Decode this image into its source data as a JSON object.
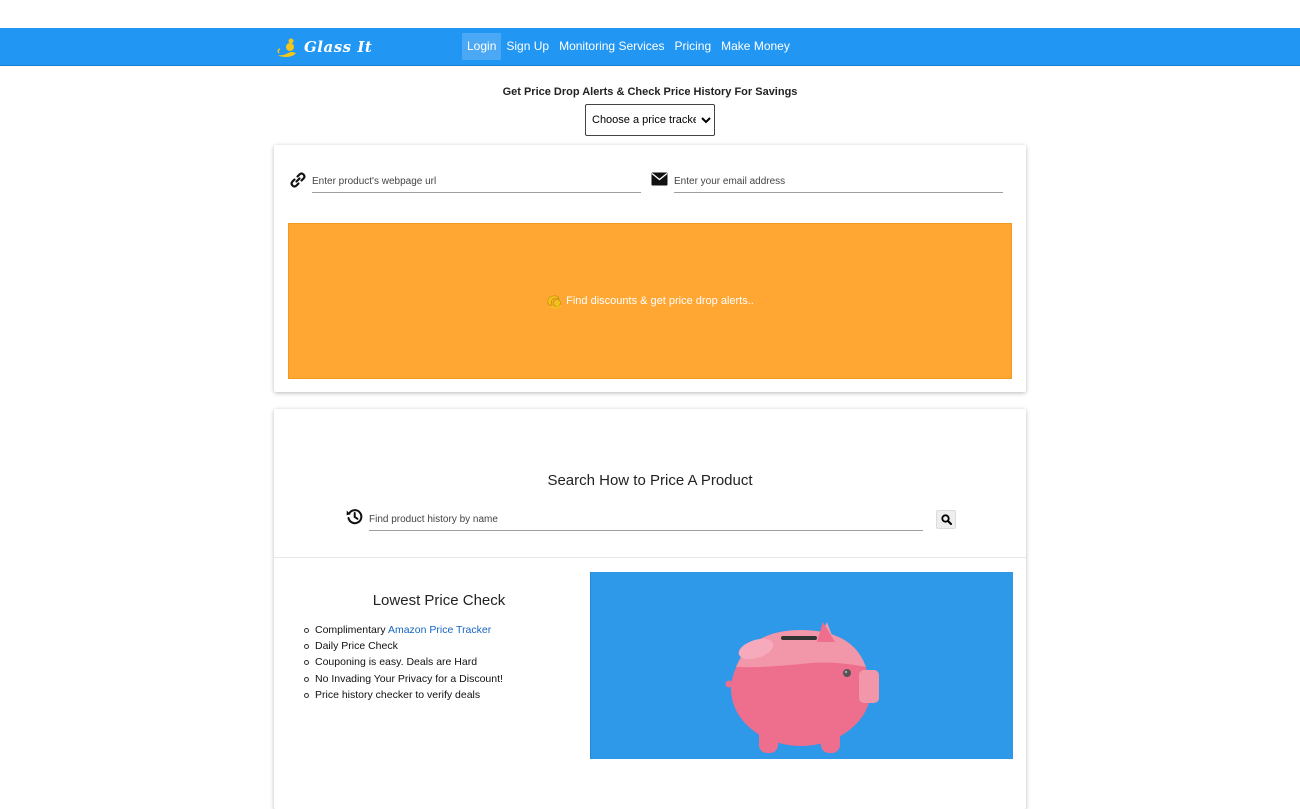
{
  "header": {
    "logo_text": "Glass It",
    "nav": [
      {
        "label": "Login",
        "active": true
      },
      {
        "label": "Sign Up"
      },
      {
        "label": "Monitoring Services"
      },
      {
        "label": "Pricing"
      },
      {
        "label": "Make Money"
      }
    ]
  },
  "tracker": {
    "headline": "Get Price Drop Alerts & Check Price History For Savings",
    "select_value": "Choose a price tracker"
  },
  "alert_form": {
    "url_placeholder": "Enter product's webpage url",
    "email_placeholder": "Enter your email address",
    "cta_label": "Find discounts & get price drop alerts..",
    "cta_color": "#ffa633"
  },
  "history": {
    "title": "Search How to Price A Product",
    "search_placeholder": "Find product history by name"
  },
  "lowest": {
    "title": "Lowest Price Check",
    "features": [
      {
        "prefix": "Complimentary ",
        "link": "Amazon Price Tracker"
      },
      {
        "text": "Daily Price Check"
      },
      {
        "text": "Couponing is easy. Deals are Hard"
      },
      {
        "text": "No Invading Your Privacy for a Discount!"
      },
      {
        "text": "Price history checker to verify deals"
      }
    ]
  },
  "colors": {
    "navbar": "#2196f3",
    "accent_orange": "#ffa633",
    "panel_blue": "#2d99e8",
    "link": "#1565c0",
    "piggy": "#ee6e8e"
  },
  "icons": [
    "genie-logo-icon",
    "link-icon",
    "envelope-icon",
    "genie-icon",
    "history-icon",
    "search-icon",
    "piggy-bank-illustration"
  ]
}
